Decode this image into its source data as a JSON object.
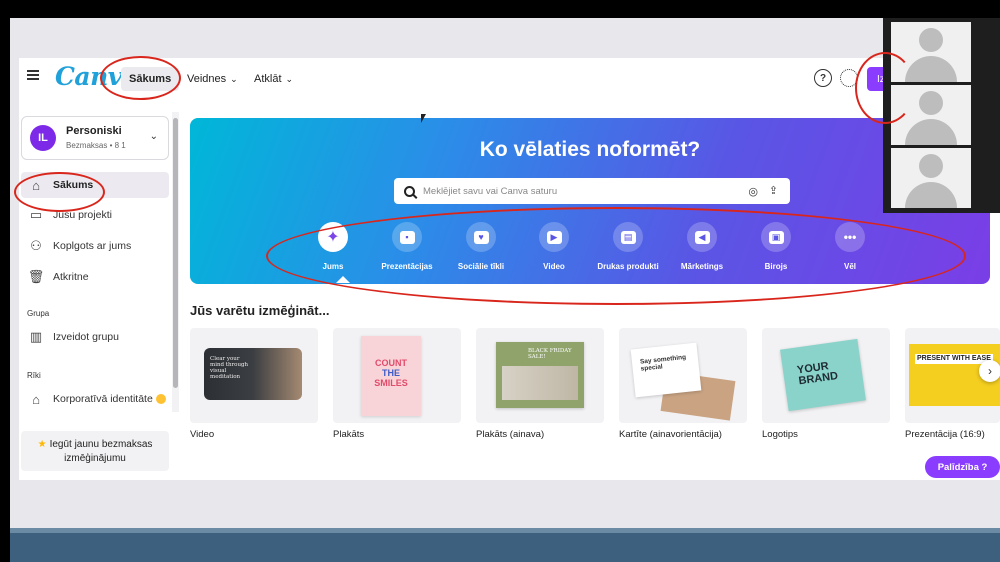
{
  "topbar": {
    "logo": "Canva",
    "nav": [
      "Sākums",
      "Veidnes",
      "Atklāt"
    ],
    "help_icon": "?",
    "create_label": "Iz"
  },
  "sidebar": {
    "account_initials": "IL",
    "account_name": "Personiski",
    "account_plan": "Bezmaksas • 8 1",
    "items": [
      {
        "label": "Sākums",
        "icon": "home-icon"
      },
      {
        "label": "Jūsu projekti",
        "icon": "folder-icon"
      },
      {
        "label": "Koplgots ar jums",
        "icon": "people-icon"
      },
      {
        "label": "Atkritne",
        "icon": "trash-icon"
      }
    ],
    "group_heading": "Grupa",
    "create_group": "Izveidot grupu",
    "tools_heading": "Rīki",
    "brand_kit": "Korporatīvā identitāte",
    "trial_line1": "Iegūt jaunu bezmaksas",
    "trial_line2": "izmēģinājumu"
  },
  "hero": {
    "title": "Ko vēlaties noformēt?",
    "search_placeholder": "Meklējiet savu vai Canva saturu",
    "categories": [
      "Jums",
      "Prezentācijas",
      "Sociālie tīkli",
      "Video",
      "Drukas produkti",
      "Mārketings",
      "Birojs",
      "Vēl"
    ]
  },
  "section": {
    "title": "Jūs varētu izmēģināt...",
    "tiles": [
      "Video",
      "Plakāts",
      "Plakāts (ainava)",
      "Kartīte (ainavorientācija)",
      "Logotips",
      "Prezentācija (16:9)"
    ],
    "thumb_video": "Clear your mind through visual meditation",
    "thumb_poster_1": "COUNT",
    "thumb_poster_2": "THE",
    "thumb_poster_3": "SMILES",
    "thumb_landscape": "BLACK FRIDAY SALE!",
    "thumb_card": "Say something special",
    "thumb_logo": "YOUR BRAND",
    "thumb_pres": "PRESENT WITH EASE"
  },
  "help_pill": "Palīdzība ?",
  "colors": {
    "accent": "#8b3dff",
    "logo": "#21a1d9",
    "annotation": "#d9261c"
  }
}
